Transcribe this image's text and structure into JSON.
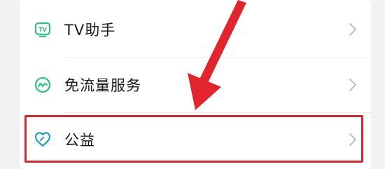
{
  "menu": {
    "items": [
      {
        "label": "TV助手",
        "icon": "tv-icon",
        "icon_text": "TV"
      },
      {
        "label": "免流量服务",
        "icon": "wave-circle-icon"
      },
      {
        "label": "公益",
        "icon": "heart-icon"
      }
    ]
  },
  "colors": {
    "icon_green": "#2cc37c",
    "icon_teal": "#1aa6b8",
    "highlight_red": "#e0262c",
    "chevron": "#b9b9b9"
  }
}
